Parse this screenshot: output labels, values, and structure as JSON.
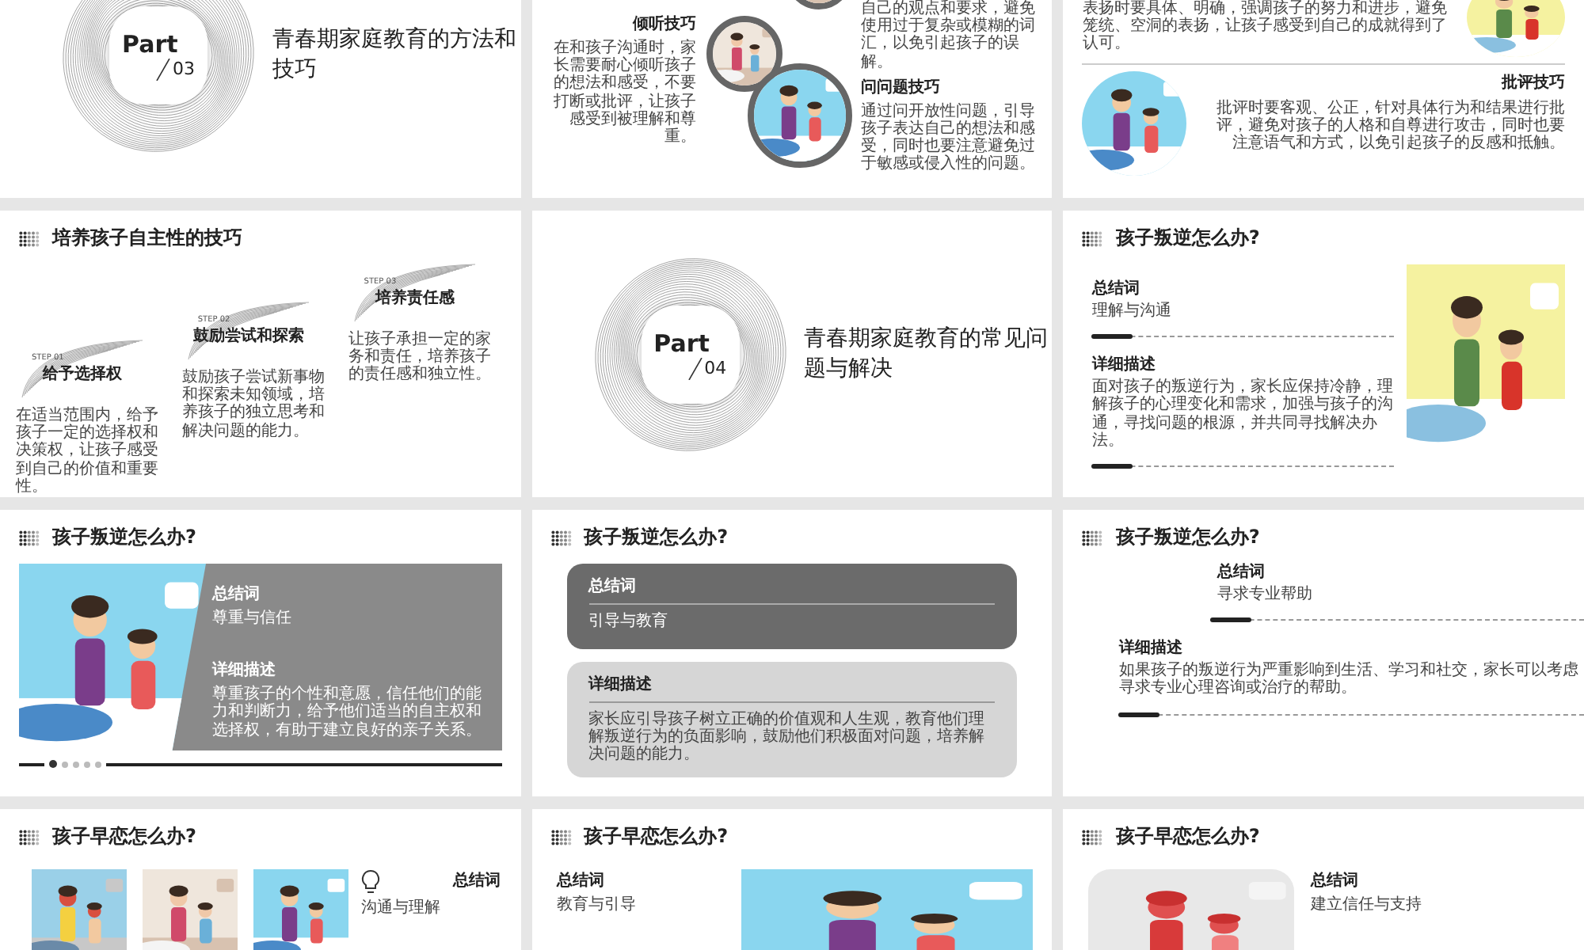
{
  "slides": [
    {
      "kind": "part",
      "part_label": "Part",
      "number": "03",
      "title": "青春期家庭教育的方法和技巧"
    },
    {
      "kind": "techniques",
      "top_text": "自己的观点和要求，避免使用过于复杂或模糊的词汇，以免引起孩子的误解。",
      "left": {
        "heading": "倾听技巧",
        "text": "在和孩子沟通时，家长需要耐心倾听孩子的想法和感受，不要打断或批评，让孩子感受到被理解和尊重。"
      },
      "right": {
        "heading": "问问题技巧",
        "text": "通过问开放性问题，引导孩子表达自己的想法和感受，同时也要注意避免过于敏感或侵入性的问题。"
      }
    },
    {
      "kind": "criticism",
      "top_text": "表扬时要具体、明确，强调孩子的努力和进步，避免笼统、空洞的表扬，让孩子感受到自己的成就得到了认可。",
      "heading": "批评技巧",
      "text": "批评时要客观、公正，针对具体行为和结果进行批评，避免对孩子的人格和自尊进行攻击，同时也要注意语气和方式，以免引起孩子的反感和抵触。"
    },
    {
      "kind": "steps",
      "title": "培养孩子自主性的技巧",
      "steps": [
        {
          "step": "STEP 01",
          "heading": "给予选择权",
          "text": "在适当范围内，给予孩子一定的选择权和决策权，让孩子感受到自己的价值和重要性。"
        },
        {
          "step": "STEP 02",
          "heading": "鼓励尝试和探索",
          "text": "鼓励孩子尝试新事物和探索未知领域，培养孩子的独立思考和解决问题的能力。"
        },
        {
          "step": "STEP 03",
          "heading": "培养责任感",
          "text": "让孩子承担一定的家务和责任，培养孩子的责任感和独立性。"
        }
      ]
    },
    {
      "kind": "part",
      "part_label": "Part",
      "number": "04",
      "title": "青春期家庭教育的常见问题与解决"
    },
    {
      "kind": "qa_image",
      "title": "孩子叛逆怎么办?",
      "summary_label": "总结词",
      "summary": "理解与沟通",
      "detail_label": "详细描述",
      "detail": "面对孩子的叛逆行为，家长应保持冷静，理解孩子的心理变化和需求，加强与孩子的沟通，寻找问题的根源，并共同寻找解决办法。"
    },
    {
      "kind": "qa_banner",
      "title": "孩子叛逆怎么办?",
      "summary_label": "总结词",
      "summary": "尊重与信任",
      "detail_label": "详细描述",
      "detail": "尊重孩子的个性和意愿，信任他们的能力和判断力，给予他们适当的自主权和选择权，有助于建立良好的亲子关系。",
      "pager": [
        {
          "selected": true
        },
        {
          "selected": false
        },
        {
          "selected": false
        },
        {
          "selected": false
        },
        {
          "selected": false
        }
      ]
    },
    {
      "kind": "qa_cards",
      "title": "孩子叛逆怎么办?",
      "summary_label": "总结词",
      "summary": "引导与教育",
      "detail_label": "详细描述",
      "detail": "家长应引导孩子树立正确的价值观和人生观，教育他们理解叛逆行为的负面影响，鼓励他们积极面对问题，培养解决问题的能力。"
    },
    {
      "kind": "qa_plain",
      "title": "孩子叛逆怎么办?",
      "summary_label": "总结词",
      "summary": "寻求专业帮助",
      "detail_label": "详细描述",
      "detail": "如果孩子的叛逆行为严重影响到生活、学习和社交，家长可以考虑寻求专业心理咨询或治疗的帮助。"
    },
    {
      "kind": "qa_pictures",
      "title": "孩子早恋怎么办?",
      "summary_label": "总结词",
      "summary": "沟通与理解"
    },
    {
      "kind": "qa_picture_right",
      "title": "孩子早恋怎么办?",
      "summary_label": "总结词",
      "summary": "教育与引导"
    },
    {
      "kind": "qa_picture_left",
      "title": "孩子早恋怎么办?",
      "summary_label": "总结词",
      "summary": "建立信任与支持"
    }
  ]
}
